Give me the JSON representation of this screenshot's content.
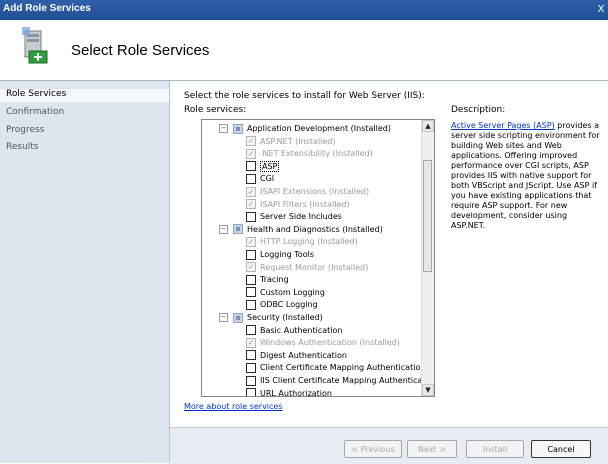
{
  "window": {
    "title": "Add Role Services",
    "close_glyph": "X"
  },
  "header": {
    "title": "Select Role Services",
    "icon": "server-roles-icon"
  },
  "nav": {
    "items": [
      "Role Services",
      "Confirmation",
      "Progress",
      "Results"
    ]
  },
  "main": {
    "instruction": "Select the role services to install for Web Server (IIS):",
    "role_services_label": "Role services:",
    "description_label": "Description:",
    "description_link": "Active Server Pages (ASP)",
    "description_text": " provides a server side scripting environment for building Web sites and Web applications. Offering improved performance over CGI scripts, ASP provides IIS with native support for both VBScript and JScript. Use ASP if you have existing applications that require ASP support. For new development, consider using ASP.NET.",
    "more_link": "More about role services"
  },
  "tree": [
    {
      "label": "Application Development  (Installed)",
      "level": 0,
      "state": "partial",
      "expander": "−"
    },
    {
      "label": "ASP.NET  (Installed)",
      "level": 1,
      "state": "checked-dim"
    },
    {
      "label": ".NET Extensibility  (Installed)",
      "level": 1,
      "state": "checked-dim"
    },
    {
      "label": "ASP",
      "level": 1,
      "state": "unchecked",
      "selected": true
    },
    {
      "label": "CGI",
      "level": 1,
      "state": "unchecked"
    },
    {
      "label": "ISAPI Extensions  (Installed)",
      "level": 1,
      "state": "checked-dim"
    },
    {
      "label": "ISAPI Filters  (Installed)",
      "level": 1,
      "state": "checked-dim"
    },
    {
      "label": "Server Side Includes",
      "level": 1,
      "state": "unchecked"
    },
    {
      "label": "Health and Diagnostics  (Installed)",
      "level": 0,
      "state": "partial",
      "expander": "−"
    },
    {
      "label": "HTTP Logging  (Installed)",
      "level": 1,
      "state": "checked-dim"
    },
    {
      "label": "Logging Tools",
      "level": 1,
      "state": "unchecked"
    },
    {
      "label": "Request Monitor  (Installed)",
      "level": 1,
      "state": "checked-dim"
    },
    {
      "label": "Tracing",
      "level": 1,
      "state": "unchecked"
    },
    {
      "label": "Custom Logging",
      "level": 1,
      "state": "unchecked"
    },
    {
      "label": "ODBC Logging",
      "level": 1,
      "state": "unchecked"
    },
    {
      "label": "Security  (Installed)",
      "level": 0,
      "state": "partial",
      "expander": "−"
    },
    {
      "label": "Basic Authentication",
      "level": 1,
      "state": "unchecked"
    },
    {
      "label": "Windows Authentication  (Installed)",
      "level": 1,
      "state": "checked-dim"
    },
    {
      "label": "Digest Authentication",
      "level": 1,
      "state": "unchecked"
    },
    {
      "label": "Client Certificate Mapping Authentication",
      "level": 1,
      "state": "unchecked"
    },
    {
      "label": "IIS Client Certificate Mapping Authentication",
      "level": 1,
      "state": "unchecked"
    },
    {
      "label": "URL Authorization",
      "level": 1,
      "state": "unchecked"
    }
  ],
  "scrollbar": {
    "up": "▲",
    "down": "▼"
  },
  "buttons": {
    "previous": "< Previous",
    "next": "Next >",
    "install": "Install",
    "cancel": "Cancel"
  },
  "check_glyph": "✓"
}
